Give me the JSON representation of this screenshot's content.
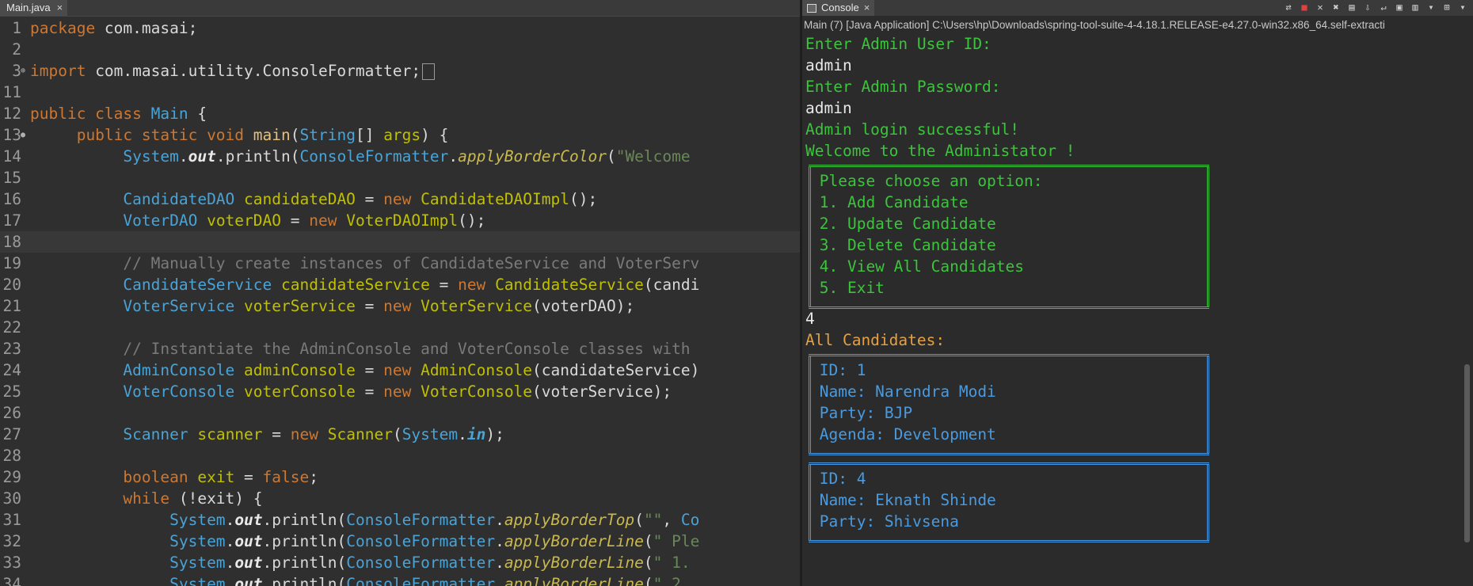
{
  "editor": {
    "tab_label": "Main.java",
    "close": "×",
    "lines": [
      {
        "no": "1",
        "tokens": [
          {
            "c": "k",
            "t": "package"
          },
          {
            "c": "p",
            "t": " com.masai;"
          }
        ]
      },
      {
        "no": "2",
        "tokens": []
      },
      {
        "no": "3",
        "fold": "⊕",
        "tokens": [
          {
            "c": "k",
            "t": "import"
          },
          {
            "c": "p",
            "t": " com.masai.utility.ConsoleFormatter;"
          }
        ],
        "collapsed": true
      },
      {
        "no": "11",
        "tokens": []
      },
      {
        "no": "12",
        "tokens": [
          {
            "c": "k",
            "t": "public class"
          },
          {
            "c": "p",
            "t": " "
          },
          {
            "c": "t",
            "t": "Main"
          },
          {
            "c": "p",
            "t": " {"
          }
        ]
      },
      {
        "no": "13",
        "fold": "●",
        "tokens": [
          {
            "c": "p",
            "t": "     "
          },
          {
            "c": "k",
            "t": "public static void"
          },
          {
            "c": "p",
            "t": " "
          },
          {
            "c": "m",
            "t": "main"
          },
          {
            "c": "p",
            "t": "("
          },
          {
            "c": "t",
            "t": "String"
          },
          {
            "c": "p",
            "t": "[] "
          },
          {
            "c": "v",
            "t": "args"
          },
          {
            "c": "p",
            "t": ") {"
          }
        ]
      },
      {
        "no": "14",
        "tokens": [
          {
            "c": "p",
            "t": "          "
          },
          {
            "c": "t",
            "t": "System"
          },
          {
            "c": "p",
            "t": "."
          },
          {
            "c": "fi",
            "t": "out"
          },
          {
            "c": "p",
            "t": ".println("
          },
          {
            "c": "t",
            "t": "ConsoleFormatter"
          },
          {
            "c": "p",
            "t": "."
          },
          {
            "c": "fc",
            "t": "applyBorderColor"
          },
          {
            "c": "p",
            "t": "("
          },
          {
            "c": "s",
            "t": "\"Welcome"
          }
        ]
      },
      {
        "no": "15",
        "tokens": []
      },
      {
        "no": "16",
        "tokens": [
          {
            "c": "p",
            "t": "          "
          },
          {
            "c": "t",
            "t": "CandidateDAO"
          },
          {
            "c": "p",
            "t": " "
          },
          {
            "c": "v",
            "t": "candidateDAO"
          },
          {
            "c": "p",
            "t": " = "
          },
          {
            "c": "k",
            "t": "new"
          },
          {
            "c": "p",
            "t": " "
          },
          {
            "c": "v",
            "t": "CandidateDAOImpl"
          },
          {
            "c": "p",
            "t": "();"
          }
        ]
      },
      {
        "no": "17",
        "tokens": [
          {
            "c": "p",
            "t": "          "
          },
          {
            "c": "t",
            "t": "VoterDAO"
          },
          {
            "c": "p",
            "t": " "
          },
          {
            "c": "v",
            "t": "voterDAO"
          },
          {
            "c": "p",
            "t": " = "
          },
          {
            "c": "k",
            "t": "new"
          },
          {
            "c": "p",
            "t": " "
          },
          {
            "c": "v",
            "t": "VoterDAOImpl"
          },
          {
            "c": "p",
            "t": "();"
          }
        ]
      },
      {
        "no": "18",
        "tokens": [],
        "current": true
      },
      {
        "no": "19",
        "tokens": [
          {
            "c": "p",
            "t": "          "
          },
          {
            "c": "c",
            "t": "// Manually create instances of CandidateService and VoterServ"
          }
        ]
      },
      {
        "no": "20",
        "tokens": [
          {
            "c": "p",
            "t": "          "
          },
          {
            "c": "t",
            "t": "CandidateService"
          },
          {
            "c": "p",
            "t": " "
          },
          {
            "c": "v",
            "t": "candidateService"
          },
          {
            "c": "p",
            "t": " = "
          },
          {
            "c": "k",
            "t": "new"
          },
          {
            "c": "p",
            "t": " "
          },
          {
            "c": "v",
            "t": "CandidateService"
          },
          {
            "c": "p",
            "t": "(candi"
          }
        ]
      },
      {
        "no": "21",
        "tokens": [
          {
            "c": "p",
            "t": "          "
          },
          {
            "c": "t",
            "t": "VoterService"
          },
          {
            "c": "p",
            "t": " "
          },
          {
            "c": "v",
            "t": "voterService"
          },
          {
            "c": "p",
            "t": " = "
          },
          {
            "c": "k",
            "t": "new"
          },
          {
            "c": "p",
            "t": " "
          },
          {
            "c": "v",
            "t": "VoterService"
          },
          {
            "c": "p",
            "t": "(voterDAO);"
          }
        ]
      },
      {
        "no": "22",
        "tokens": []
      },
      {
        "no": "23",
        "tokens": [
          {
            "c": "p",
            "t": "          "
          },
          {
            "c": "c",
            "t": "// Instantiate the AdminConsole and VoterConsole classes with"
          }
        ]
      },
      {
        "no": "24",
        "tokens": [
          {
            "c": "p",
            "t": "          "
          },
          {
            "c": "t",
            "t": "AdminConsole"
          },
          {
            "c": "p",
            "t": " "
          },
          {
            "c": "v",
            "t": "adminConsole"
          },
          {
            "c": "p",
            "t": " = "
          },
          {
            "c": "k",
            "t": "new"
          },
          {
            "c": "p",
            "t": " "
          },
          {
            "c": "v",
            "t": "AdminConsole"
          },
          {
            "c": "p",
            "t": "(candidateService)"
          }
        ]
      },
      {
        "no": "25",
        "tokens": [
          {
            "c": "p",
            "t": "          "
          },
          {
            "c": "t",
            "t": "VoterConsole"
          },
          {
            "c": "p",
            "t": " "
          },
          {
            "c": "v",
            "t": "voterConsole"
          },
          {
            "c": "p",
            "t": " = "
          },
          {
            "c": "k",
            "t": "new"
          },
          {
            "c": "p",
            "t": " "
          },
          {
            "c": "v",
            "t": "VoterConsole"
          },
          {
            "c": "p",
            "t": "(voterService);"
          }
        ]
      },
      {
        "no": "26",
        "tokens": []
      },
      {
        "no": "27",
        "tokens": [
          {
            "c": "p",
            "t": "          "
          },
          {
            "c": "t",
            "t": "Scanner"
          },
          {
            "c": "p",
            "t": " "
          },
          {
            "c": "v",
            "t": "scanner"
          },
          {
            "c": "p",
            "t": " = "
          },
          {
            "c": "k",
            "t": "new"
          },
          {
            "c": "p",
            "t": " "
          },
          {
            "c": "v",
            "t": "Scanner"
          },
          {
            "c": "p",
            "t": "("
          },
          {
            "c": "t",
            "t": "System"
          },
          {
            "c": "p",
            "t": "."
          },
          {
            "c": "st",
            "t": "in"
          },
          {
            "c": "p",
            "t": ");"
          }
        ]
      },
      {
        "no": "28",
        "tokens": []
      },
      {
        "no": "29",
        "tokens": [
          {
            "c": "p",
            "t": "          "
          },
          {
            "c": "k",
            "t": "boolean"
          },
          {
            "c": "p",
            "t": " "
          },
          {
            "c": "v",
            "t": "exit"
          },
          {
            "c": "p",
            "t": " = "
          },
          {
            "c": "k",
            "t": "false"
          },
          {
            "c": "p",
            "t": ";"
          }
        ]
      },
      {
        "no": "30",
        "tokens": [
          {
            "c": "p",
            "t": "          "
          },
          {
            "c": "k",
            "t": "while"
          },
          {
            "c": "p",
            "t": " (!exit) {"
          }
        ]
      },
      {
        "no": "31",
        "tokens": [
          {
            "c": "p",
            "t": "               "
          },
          {
            "c": "t",
            "t": "System"
          },
          {
            "c": "p",
            "t": "."
          },
          {
            "c": "fi",
            "t": "out"
          },
          {
            "c": "p",
            "t": ".println("
          },
          {
            "c": "t",
            "t": "ConsoleFormatter"
          },
          {
            "c": "p",
            "t": "."
          },
          {
            "c": "fc",
            "t": "applyBorderTop"
          },
          {
            "c": "p",
            "t": "("
          },
          {
            "c": "s",
            "t": "\"\""
          },
          {
            "c": "p",
            "t": ", "
          },
          {
            "c": "t",
            "t": "Co"
          }
        ]
      },
      {
        "no": "32",
        "tokens": [
          {
            "c": "p",
            "t": "               "
          },
          {
            "c": "t",
            "t": "System"
          },
          {
            "c": "p",
            "t": "."
          },
          {
            "c": "fi",
            "t": "out"
          },
          {
            "c": "p",
            "t": ".println("
          },
          {
            "c": "t",
            "t": "ConsoleFormatter"
          },
          {
            "c": "p",
            "t": "."
          },
          {
            "c": "fc",
            "t": "applyBorderLine"
          },
          {
            "c": "p",
            "t": "("
          },
          {
            "c": "s",
            "t": "\" Ple"
          }
        ]
      },
      {
        "no": "33",
        "tokens": [
          {
            "c": "p",
            "t": "               "
          },
          {
            "c": "t",
            "t": "System"
          },
          {
            "c": "p",
            "t": "."
          },
          {
            "c": "fi",
            "t": "out"
          },
          {
            "c": "p",
            "t": ".println("
          },
          {
            "c": "t",
            "t": "ConsoleFormatter"
          },
          {
            "c": "p",
            "t": "."
          },
          {
            "c": "fc",
            "t": "applyBorderLine"
          },
          {
            "c": "p",
            "t": "("
          },
          {
            "c": "s",
            "t": "\" 1."
          }
        ]
      },
      {
        "no": "34",
        "tokens": [
          {
            "c": "p",
            "t": "               "
          },
          {
            "c": "t",
            "t": "System"
          },
          {
            "c": "p",
            "t": "."
          },
          {
            "c": "fi",
            "t": "out"
          },
          {
            "c": "p",
            "t": ".println("
          },
          {
            "c": "t",
            "t": "ConsoleFormatter"
          },
          {
            "c": "p",
            "t": "."
          },
          {
            "c": "fc",
            "t": "applyBorderLine"
          },
          {
            "c": "p",
            "t": "("
          },
          {
            "c": "s",
            "t": "\" 2."
          }
        ]
      }
    ]
  },
  "console": {
    "tab_label": "Console",
    "close": "×",
    "description": "Main (7) [Java Application] C:\\Users\\hp\\Downloads\\spring-tool-suite-4-4.18.1.RELEASE-e4.27.0-win32.x86_64.self-extracti",
    "toolbar_icons": [
      "link-icon",
      "terminate-icon",
      "remove-launch-icon",
      "remove-all-icon",
      "copy-icon",
      "scroll-lock-icon",
      "word-wrap-icon",
      "pin-icon",
      "display-console-icon",
      "console-menu-icon",
      "open-console-icon",
      "view-menu-icon"
    ],
    "lines_top": [
      {
        "text": "Enter Admin User ID:",
        "color": "g"
      },
      {
        "text": "admin",
        "color": "w"
      },
      {
        "text": "Enter Admin Password:",
        "color": "g"
      },
      {
        "text": "admin",
        "color": "w"
      },
      {
        "text": "Admin login successful!",
        "color": "g"
      },
      {
        "text": "Welcome to the Administator !",
        "color": "g"
      }
    ],
    "menu": [
      "Please choose an option:",
      "1. Add Candidate",
      "2. Update Candidate",
      "3. Delete Candidate",
      "4. View All Candidates",
      "5. Exit"
    ],
    "choice": "4",
    "all_candidates_label": "All Candidates:",
    "candidates": [
      [
        "ID: 1",
        "Name: Narendra Modi",
        "Party: BJP",
        "Agenda: Development"
      ],
      [
        "ID: 4",
        "Name: Eknath Shinde",
        "Party: Shivsena"
      ]
    ],
    "colors": {
      "green": "#3cc43c",
      "orange": "#e5a040",
      "blue": "#4a9ae0"
    }
  }
}
